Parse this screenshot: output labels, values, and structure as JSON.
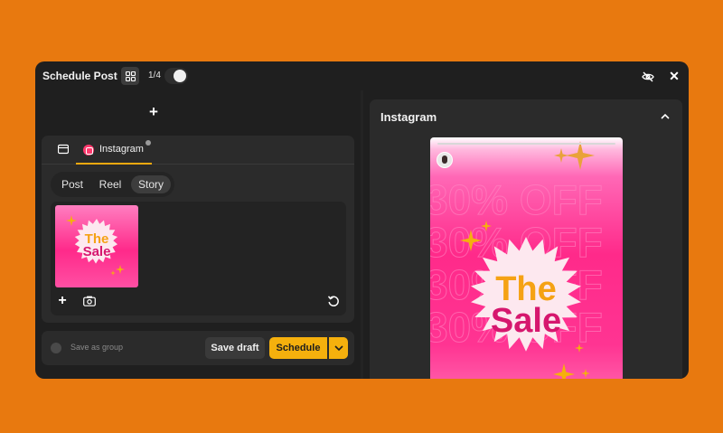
{
  "window": {
    "title": "Schedule Post",
    "page_indicator": "1/4"
  },
  "editor": {
    "network_tab": "Instagram",
    "post_types": [
      {
        "label": "Post",
        "active": false
      },
      {
        "label": "Reel",
        "active": false
      },
      {
        "label": "Story",
        "active": true
      }
    ],
    "media": {
      "thumbnail_text_1": "The",
      "thumbnail_text_2": "Sale"
    }
  },
  "footer": {
    "save_as_group_label": "Save as group",
    "save_draft_label": "Save draft",
    "schedule_label": "Schedule"
  },
  "preview": {
    "title": "Instagram",
    "story_text_1": "The",
    "story_text_2": "Sale",
    "background_text": "30% OFF"
  },
  "colors": {
    "background": "#e8790f",
    "accent": "#f5b00d",
    "instagram": "#ff3a6e",
    "pink": "#ff2a8a",
    "sale_text": "#d6176e",
    "the_text": "#f5a214"
  },
  "icons": [
    "grid-icon",
    "eye-off-icon",
    "close-icon",
    "plus-icon",
    "film-icon",
    "instagram-icon",
    "camera-icon",
    "undo-icon",
    "chevron-down-icon",
    "chevron-up-icon"
  ]
}
